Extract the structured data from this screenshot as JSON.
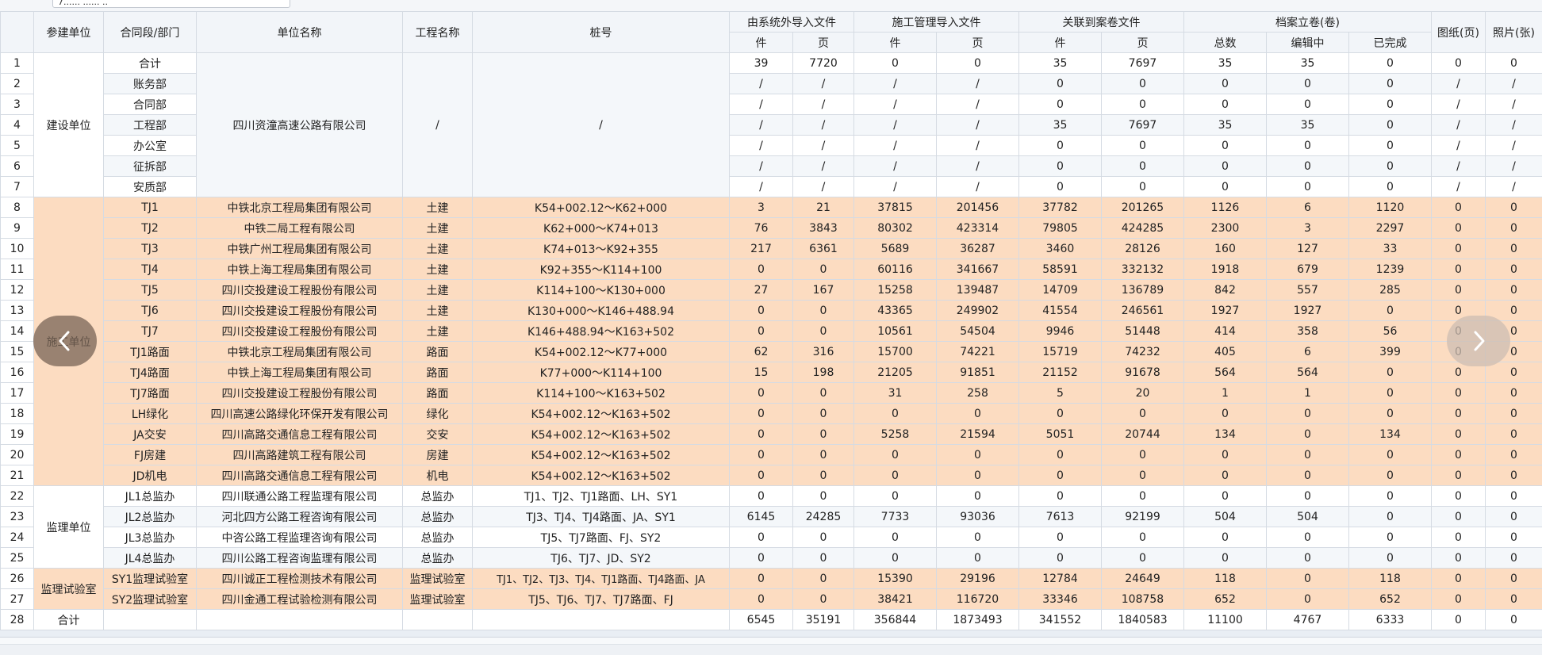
{
  "search": {
    "value": "7...... ...... .."
  },
  "headers": {
    "idx": "",
    "participant": "参建单位",
    "contract": "合同段/部门",
    "unit_name": "单位名称",
    "project_name": "工程名称",
    "pile": "桩号",
    "ext_import": "由系统外导入文件",
    "construct_import": "施工管理导入文件",
    "linked": "关联到案卷文件",
    "archive": "档案立卷(卷)",
    "drawing": "图纸(页)",
    "photo": "照片(张)",
    "sub_count": "件",
    "sub_page": "页",
    "sub_total": "总数",
    "sub_editing": "编辑中",
    "sub_done": "已完成"
  },
  "categories": {
    "build": "建设单位",
    "construction": "施工单位",
    "supervision": "监理单位",
    "lab": "监理试验室"
  },
  "build_unit": {
    "name": "四川资潼高速公路有限公司",
    "project": "/",
    "pile": "/"
  },
  "rows": [
    {
      "idx": "1",
      "contract": "合计",
      "unit": "",
      "project": "",
      "pile": "",
      "c1": "39",
      "c2": "7720",
      "c3": "0",
      "c4": "0",
      "c5": "35",
      "c6": "7697",
      "c7": "35",
      "c8": "35",
      "c9": "0",
      "c10": "0",
      "c11": "0"
    },
    {
      "idx": "2",
      "contract": "账务部",
      "unit": "",
      "project": "",
      "pile": "",
      "c1": "/",
      "c2": "/",
      "c3": "/",
      "c4": "/",
      "c5": "0",
      "c6": "0",
      "c7": "0",
      "c8": "0",
      "c9": "0",
      "c10": "/",
      "c11": "/"
    },
    {
      "idx": "3",
      "contract": "合同部",
      "unit": "",
      "project": "",
      "pile": "",
      "c1": "/",
      "c2": "/",
      "c3": "/",
      "c4": "/",
      "c5": "0",
      "c6": "0",
      "c7": "0",
      "c8": "0",
      "c9": "0",
      "c10": "/",
      "c11": "/"
    },
    {
      "idx": "4",
      "contract": "工程部",
      "unit": "",
      "project": "",
      "pile": "",
      "c1": "/",
      "c2": "/",
      "c3": "/",
      "c4": "/",
      "c5": "35",
      "c6": "7697",
      "c7": "35",
      "c8": "35",
      "c9": "0",
      "c10": "/",
      "c11": "/"
    },
    {
      "idx": "5",
      "contract": "办公室",
      "unit": "",
      "project": "",
      "pile": "",
      "c1": "/",
      "c2": "/",
      "c3": "/",
      "c4": "/",
      "c5": "0",
      "c6": "0",
      "c7": "0",
      "c8": "0",
      "c9": "0",
      "c10": "/",
      "c11": "/"
    },
    {
      "idx": "6",
      "contract": "征拆部",
      "unit": "",
      "project": "",
      "pile": "",
      "c1": "/",
      "c2": "/",
      "c3": "/",
      "c4": "/",
      "c5": "0",
      "c6": "0",
      "c7": "0",
      "c8": "0",
      "c9": "0",
      "c10": "/",
      "c11": "/"
    },
    {
      "idx": "7",
      "contract": "安质部",
      "unit": "",
      "project": "",
      "pile": "",
      "c1": "/",
      "c2": "/",
      "c3": "/",
      "c4": "/",
      "c5": "0",
      "c6": "0",
      "c7": "0",
      "c8": "0",
      "c9": "0",
      "c10": "/",
      "c11": "/"
    },
    {
      "idx": "8",
      "contract": "TJ1",
      "unit": "中铁北京工程局集团有限公司",
      "project": "土建",
      "pile": "K54+002.12～K62+000",
      "c1": "3",
      "c2": "21",
      "c3": "37815",
      "c4": "201456",
      "c5": "37782",
      "c6": "201265",
      "c7": "1126",
      "c8": "6",
      "c9": "1120",
      "c10": "0",
      "c11": "0"
    },
    {
      "idx": "9",
      "contract": "TJ2",
      "unit": "中铁二局工程有限公司",
      "project": "土建",
      "pile": "K62+000～K74+013",
      "c1": "76",
      "c2": "3843",
      "c3": "80302",
      "c4": "423314",
      "c5": "79805",
      "c6": "424285",
      "c7": "2300",
      "c8": "3",
      "c9": "2297",
      "c10": "0",
      "c11": "0"
    },
    {
      "idx": "10",
      "contract": "TJ3",
      "unit": "中铁广州工程局集团有限公司",
      "project": "土建",
      "pile": "K74+013～K92+355",
      "c1": "217",
      "c2": "6361",
      "c3": "5689",
      "c4": "36287",
      "c5": "3460",
      "c6": "28126",
      "c7": "160",
      "c8": "127",
      "c9": "33",
      "c10": "0",
      "c11": "0"
    },
    {
      "idx": "11",
      "contract": "TJ4",
      "unit": "中铁上海工程局集团有限公司",
      "project": "土建",
      "pile": "K92+355～K114+100",
      "c1": "0",
      "c2": "0",
      "c3": "60116",
      "c4": "341667",
      "c5": "58591",
      "c6": "332132",
      "c7": "1918",
      "c8": "679",
      "c9": "1239",
      "c10": "0",
      "c11": "0"
    },
    {
      "idx": "12",
      "contract": "TJ5",
      "unit": "四川交投建设工程股份有限公司",
      "project": "土建",
      "pile": "K114+100～K130+000",
      "c1": "27",
      "c2": "167",
      "c3": "15258",
      "c4": "139487",
      "c5": "14709",
      "c6": "136789",
      "c7": "842",
      "c8": "557",
      "c9": "285",
      "c10": "0",
      "c11": "0"
    },
    {
      "idx": "13",
      "contract": "TJ6",
      "unit": "四川交投建设工程股份有限公司",
      "project": "土建",
      "pile": "K130+000～K146+488.94",
      "c1": "0",
      "c2": "0",
      "c3": "43365",
      "c4": "249902",
      "c5": "41554",
      "c6": "246561",
      "c7": "1927",
      "c8": "1927",
      "c9": "0",
      "c10": "0",
      "c11": "0"
    },
    {
      "idx": "14",
      "contract": "TJ7",
      "unit": "四川交投建设工程股份有限公司",
      "project": "土建",
      "pile": "K146+488.94～K163+502",
      "c1": "0",
      "c2": "0",
      "c3": "10561",
      "c4": "54504",
      "c5": "9946",
      "c6": "51448",
      "c7": "414",
      "c8": "358",
      "c9": "56",
      "c10": "0",
      "c11": "0"
    },
    {
      "idx": "15",
      "contract": "TJ1路面",
      "unit": "中铁北京工程局集团有限公司",
      "project": "路面",
      "pile": "K54+002.12～K77+000",
      "c1": "62",
      "c2": "316",
      "c3": "15700",
      "c4": "74221",
      "c5": "15719",
      "c6": "74232",
      "c7": "405",
      "c8": "6",
      "c9": "399",
      "c10": "0",
      "c11": "0"
    },
    {
      "idx": "16",
      "contract": "TJ4路面",
      "unit": "中铁上海工程局集团有限公司",
      "project": "路面",
      "pile": "K77+000～K114+100",
      "c1": "15",
      "c2": "198",
      "c3": "21205",
      "c4": "91851",
      "c5": "21152",
      "c6": "91678",
      "c7": "564",
      "c8": "564",
      "c9": "0",
      "c10": "0",
      "c11": "0"
    },
    {
      "idx": "17",
      "contract": "TJ7路面",
      "unit": "四川交投建设工程股份有限公司",
      "project": "路面",
      "pile": "K114+100～K163+502",
      "c1": "0",
      "c2": "0",
      "c3": "31",
      "c4": "258",
      "c5": "5",
      "c6": "20",
      "c7": "1",
      "c8": "1",
      "c9": "0",
      "c10": "0",
      "c11": "0"
    },
    {
      "idx": "18",
      "contract": "LH绿化",
      "unit": "四川高速公路绿化环保开发有限公司",
      "project": "绿化",
      "pile": "K54+002.12～K163+502",
      "c1": "0",
      "c2": "0",
      "c3": "0",
      "c4": "0",
      "c5": "0",
      "c6": "0",
      "c7": "0",
      "c8": "0",
      "c9": "0",
      "c10": "0",
      "c11": "0"
    },
    {
      "idx": "19",
      "contract": "JA交安",
      "unit": "四川高路交通信息工程有限公司",
      "project": "交安",
      "pile": "K54+002.12～K163+502",
      "c1": "0",
      "c2": "0",
      "c3": "5258",
      "c4": "21594",
      "c5": "5051",
      "c6": "20744",
      "c7": "134",
      "c8": "0",
      "c9": "134",
      "c10": "0",
      "c11": "0"
    },
    {
      "idx": "20",
      "contract": "FJ房建",
      "unit": "四川高路建筑工程有限公司",
      "project": "房建",
      "pile": "K54+002.12～K163+502",
      "c1": "0",
      "c2": "0",
      "c3": "0",
      "c4": "0",
      "c5": "0",
      "c6": "0",
      "c7": "0",
      "c8": "0",
      "c9": "0",
      "c10": "0",
      "c11": "0"
    },
    {
      "idx": "21",
      "contract": "JD机电",
      "unit": "四川高路交通信息工程有限公司",
      "project": "机电",
      "pile": "K54+002.12～K163+502",
      "c1": "0",
      "c2": "0",
      "c3": "0",
      "c4": "0",
      "c5": "0",
      "c6": "0",
      "c7": "0",
      "c8": "0",
      "c9": "0",
      "c10": "0",
      "c11": "0"
    },
    {
      "idx": "22",
      "contract": "JL1总监办",
      "unit": "四川联通公路工程监理有限公司",
      "project": "总监办",
      "pile": "TJ1、TJ2、TJ1路面、LH、SY1",
      "c1": "0",
      "c2": "0",
      "c3": "0",
      "c4": "0",
      "c5": "0",
      "c6": "0",
      "c7": "0",
      "c8": "0",
      "c9": "0",
      "c10": "0",
      "c11": "0"
    },
    {
      "idx": "23",
      "contract": "JL2总监办",
      "unit": "河北四方公路工程咨询有限公司",
      "project": "总监办",
      "pile": "TJ3、TJ4、TJ4路面、JA、SY1",
      "c1": "6145",
      "c2": "24285",
      "c3": "7733",
      "c4": "93036",
      "c5": "7613",
      "c6": "92199",
      "c7": "504",
      "c8": "504",
      "c9": "0",
      "c10": "0",
      "c11": "0"
    },
    {
      "idx": "24",
      "contract": "JL3总监办",
      "unit": "中咨公路工程监理咨询有限公司",
      "project": "总监办",
      "pile": "TJ5、TJ7路面、FJ、SY2",
      "c1": "0",
      "c2": "0",
      "c3": "0",
      "c4": "0",
      "c5": "0",
      "c6": "0",
      "c7": "0",
      "c8": "0",
      "c9": "0",
      "c10": "0",
      "c11": "0"
    },
    {
      "idx": "25",
      "contract": "JL4总监办",
      "unit": "四川公路工程咨询监理有限公司",
      "project": "总监办",
      "pile": "TJ6、TJ7、JD、SY2",
      "c1": "0",
      "c2": "0",
      "c3": "0",
      "c4": "0",
      "c5": "0",
      "c6": "0",
      "c7": "0",
      "c8": "0",
      "c9": "0",
      "c10": "0",
      "c11": "0"
    },
    {
      "idx": "26",
      "contract": "SY1监理试验室",
      "unit": "四川诚正工程检测技术有限公司",
      "project": "监理试验室",
      "pile": "TJ1、TJ2、TJ3、TJ4、TJ1路面、TJ4路面、JA",
      "c1": "0",
      "c2": "0",
      "c3": "15390",
      "c4": "29196",
      "c5": "12784",
      "c6": "24649",
      "c7": "118",
      "c8": "0",
      "c9": "118",
      "c10": "0",
      "c11": "0"
    },
    {
      "idx": "27",
      "contract": "SY2监理试验室",
      "unit": "四川金通工程试验检测有限公司",
      "project": "监理试验室",
      "pile": "TJ5、TJ6、TJ7、TJ7路面、FJ",
      "c1": "0",
      "c2": "0",
      "c3": "38421",
      "c4": "116720",
      "c5": "33346",
      "c6": "108758",
      "c7": "652",
      "c8": "0",
      "c9": "652",
      "c10": "0",
      "c11": "0"
    },
    {
      "idx": "28",
      "contract": "",
      "unit": "",
      "project": "",
      "pile": "",
      "c1": "6545",
      "c2": "35191",
      "c3": "356844",
      "c4": "1873493",
      "c5": "341552",
      "c6": "1840583",
      "c7": "11100",
      "c8": "4767",
      "c9": "6333",
      "c10": "0",
      "c11": "0"
    }
  ],
  "total_label": "合计",
  "nav": {
    "prev_icon": "chevron-left-icon",
    "next_icon": "chevron-right-icon"
  },
  "colors": {
    "orange_row": "#fcdcc1",
    "alt_row": "#f4f7fa",
    "header_bg": "#f2f5f9",
    "border": "#d5dbe3"
  }
}
